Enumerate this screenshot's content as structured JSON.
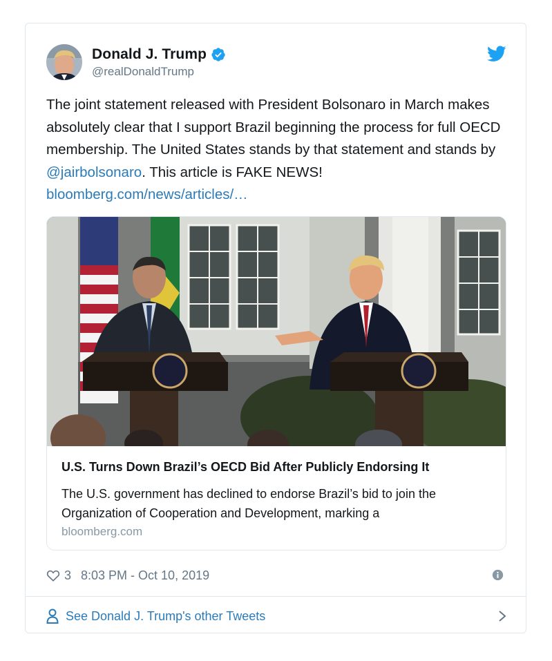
{
  "author": {
    "name": "Donald J. Trump",
    "handle": "@realDonaldTrump",
    "verified_icon": "verified-badge-icon",
    "avatar": "avatar"
  },
  "tweet": {
    "text_before_mention": "The joint statement released with President Bolsonaro in March makes absolutely clear that I support Brazil beginning the process for full OECD membership. The United States stands by that statement and stands by ",
    "mention": "@jairbolsonaro",
    "text_after_mention": ". This article is FAKE NEWS! ",
    "link": "bloomberg.com/news/articles/…"
  },
  "link_card": {
    "title": "U.S. Turns Down Brazil’s OECD Bid After Publicly Endorsing It",
    "description": "The U.S. government has declined to endorse Brazil’s bid to join the Organization of Cooperation and Development, marking a",
    "domain": "bloomberg.com"
  },
  "footer": {
    "like_count": "3",
    "timestamp": "8:03 PM - Oct 10, 2019"
  },
  "see_more": {
    "label": "See Donald J. Trump's other Tweets"
  },
  "colors": {
    "link": "#2b7bb9",
    "muted": "#657786",
    "twitter_blue": "#1da1f2",
    "border": "#e1e8ed"
  }
}
